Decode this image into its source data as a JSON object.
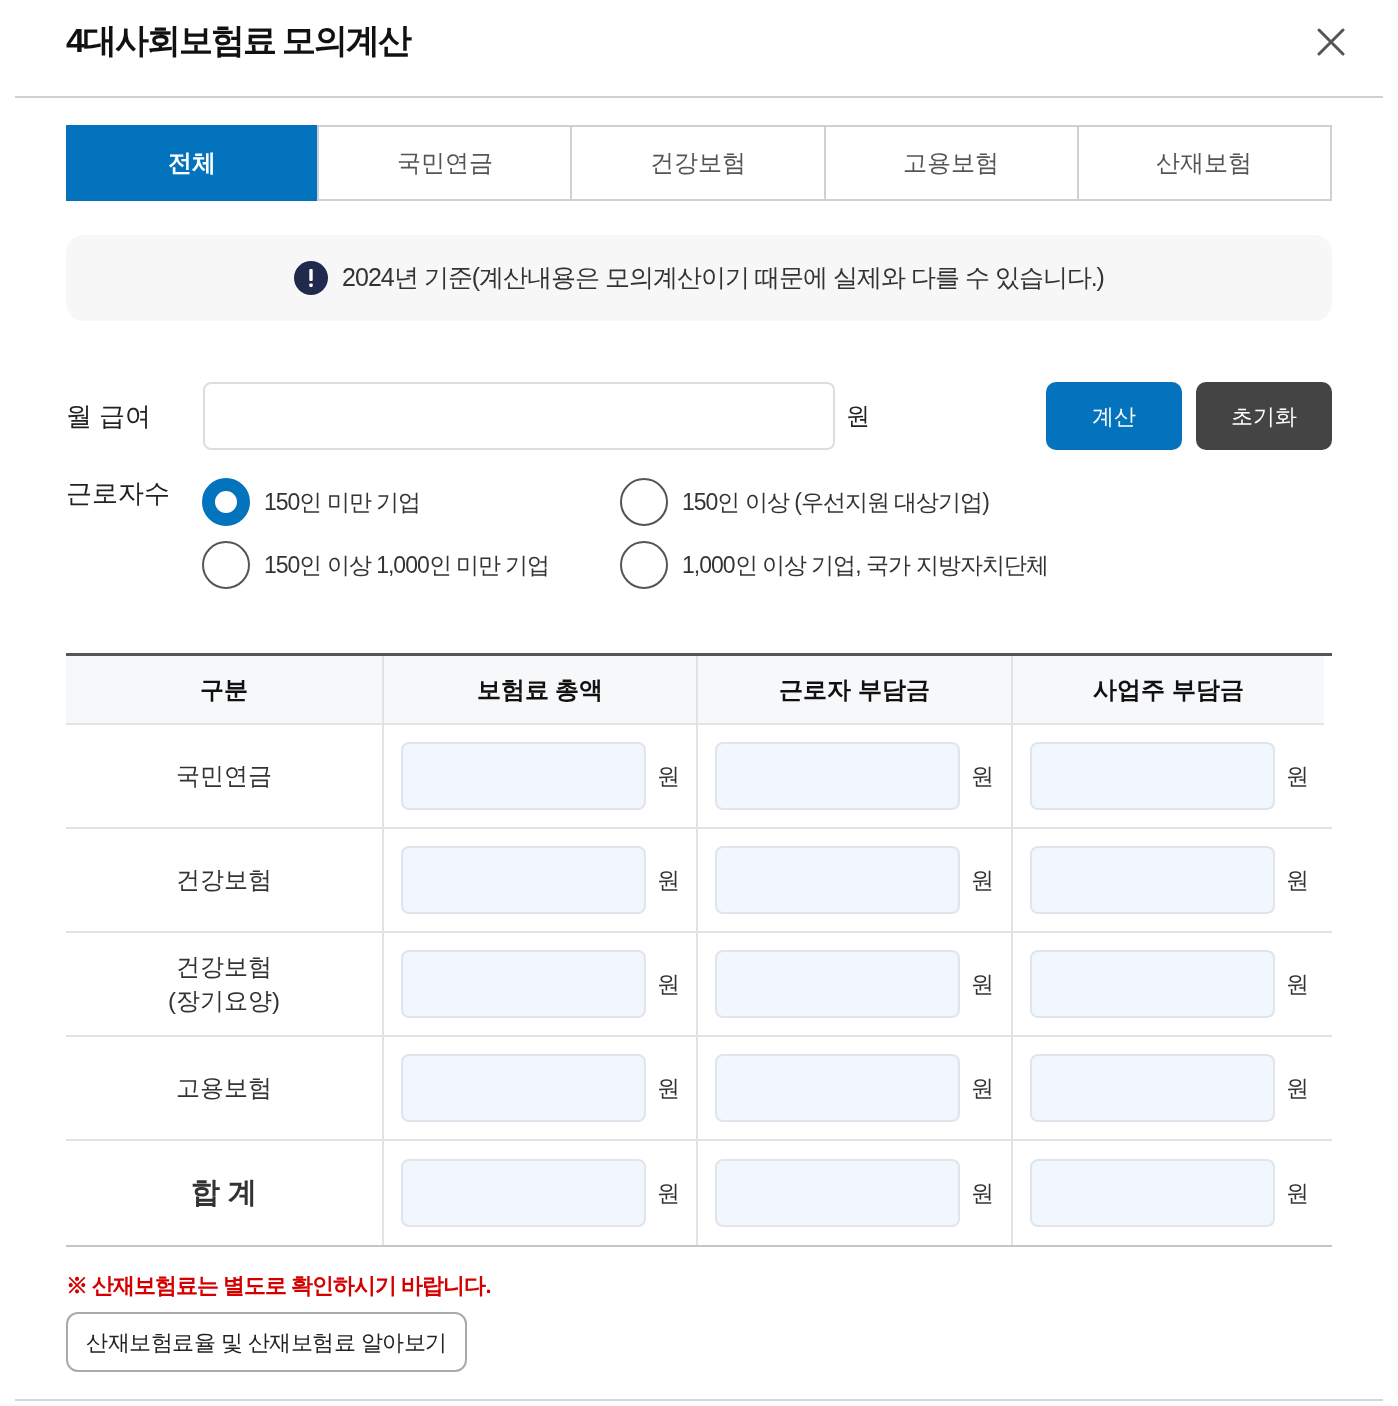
{
  "header": {
    "title": "4대사회보험료 모의계산"
  },
  "tabs": [
    {
      "label": "전체",
      "selected": true
    },
    {
      "label": "국민연금",
      "selected": false
    },
    {
      "label": "건강보험",
      "selected": false
    },
    {
      "label": "고용보험",
      "selected": false
    },
    {
      "label": "산재보험",
      "selected": false
    }
  ],
  "notice": {
    "text": "2024년 기준(계산내용은 모의계산이기 때문에 실제와 다를 수 있습니다.)"
  },
  "salary": {
    "label": "월 급여",
    "unit": "원"
  },
  "buttons": [
    {
      "kind": "primary",
      "label": "계산"
    },
    {
      "kind": "dark",
      "label": "초기화"
    }
  ],
  "workers": {
    "label": "근로자수",
    "options": [
      {
        "label": "150인 미만 기업",
        "selected": true
      },
      {
        "label": "150인 이상 (우선지원 대상기업)",
        "selected": false
      },
      {
        "label": "150인 이상 1,000인 미만 기업",
        "selected": false
      },
      {
        "label": "1,000인 이상 기업, 국가 지방자치단체",
        "selected": false
      }
    ]
  },
  "table": {
    "columns": [
      "구분",
      "보험료 총액",
      "근로자 부담금",
      "사업주 부담금"
    ],
    "rows": [
      {
        "kind": "item",
        "label": "국민연금",
        "cells": [
          {
            "unit": "원"
          },
          {
            "unit": "원"
          },
          {
            "unit": "원"
          }
        ]
      },
      {
        "kind": "item",
        "label": "건강보험",
        "cells": [
          {
            "unit": "원"
          },
          {
            "unit": "원"
          },
          {
            "unit": "원"
          }
        ]
      },
      {
        "kind": "item",
        "label": "건강보험\n(장기요양)",
        "cells": [
          {
            "unit": "원"
          },
          {
            "unit": "원"
          },
          {
            "unit": "원"
          }
        ]
      },
      {
        "kind": "item",
        "label": "고용보험",
        "cells": [
          {
            "unit": "원"
          },
          {
            "unit": "원"
          },
          {
            "unit": "원"
          }
        ]
      },
      {
        "kind": "total",
        "label": "합 계",
        "cells": [
          {
            "unit": "원"
          },
          {
            "unit": "원"
          },
          {
            "unit": "원"
          }
        ]
      }
    ]
  },
  "footer": {
    "warning": "※ 산재보험료는 별도로 확인하시기 바랍니다.",
    "link_button": "산재보험료율 및 산재보험료 알아보기"
  }
}
